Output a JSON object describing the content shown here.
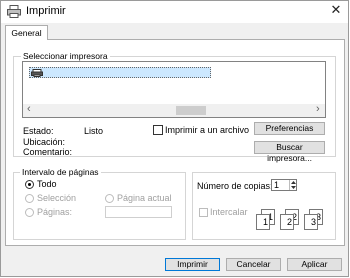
{
  "window": {
    "title": "Imprimir",
    "close_glyph": "✕"
  },
  "tabs": [
    {
      "label": "General",
      "selected": true
    }
  ],
  "printer_section": {
    "label": "Seleccionar impresora",
    "selected_printer_name": "",
    "scroll_left_glyph": "‹",
    "scroll_right_glyph": "›"
  },
  "status": {
    "estado_label": "Estado:",
    "estado_value": "Listo",
    "ubicacion_label": "Ubicación:",
    "ubicacion_value": "",
    "comentario_label": "Comentario:",
    "comentario_value": ""
  },
  "print_to_file": {
    "label": "Imprimir a un archivo",
    "checked": false
  },
  "buttons": {
    "preferences": "Preferencias",
    "find_printer": "Buscar impresora...",
    "print": "Imprimir",
    "cancel": "Cancelar",
    "apply": "Aplicar"
  },
  "page_range": {
    "label": "Intervalo de páginas",
    "all": "Todo",
    "selection": "Selección",
    "current_page": "Página actual",
    "pages": "Páginas:",
    "selected_option": "all"
  },
  "copies": {
    "label": "Número de copias:",
    "value": "1",
    "collate_label": "Intercalar",
    "collate_checked": false,
    "collate_pages": [
      "1",
      "1",
      "2",
      "2",
      "3",
      "3"
    ]
  },
  "icons": {
    "app": "printer-icon",
    "printer_item": "printer-icon",
    "spinner": "spinner-icon"
  }
}
